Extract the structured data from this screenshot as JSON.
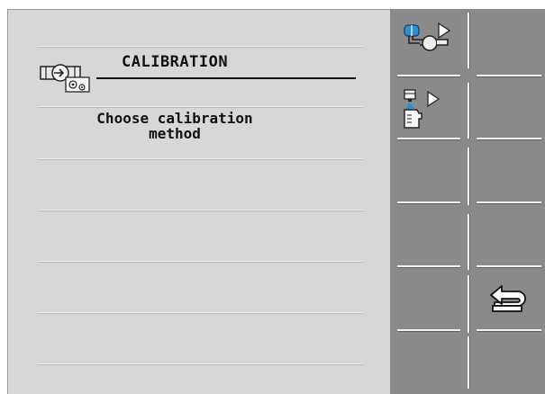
{
  "header": {
    "title": "CALIBRATION",
    "icon": "calibration-gear-icon"
  },
  "main": {
    "message": "Choose calibration\nmethod"
  },
  "softkeys": [
    {
      "name": "softkey-flow-calibration",
      "icon": "pipe-flow-calibration-icon"
    },
    {
      "name": "softkey-nozzle-calibration",
      "icon": "nozzle-jug-calibration-icon"
    },
    {
      "name": "softkey-empty-3",
      "icon": ""
    },
    {
      "name": "softkey-empty-4",
      "icon": ""
    },
    {
      "name": "softkey-back",
      "icon": "return-arrow-icon"
    },
    {
      "name": "softkey-empty-6",
      "icon": ""
    }
  ],
  "colors": {
    "panel": "#d7d7d7",
    "softkey_panel": "#8a8a8a",
    "accent_blue": "#2e8fd0",
    "text": "#111111"
  }
}
